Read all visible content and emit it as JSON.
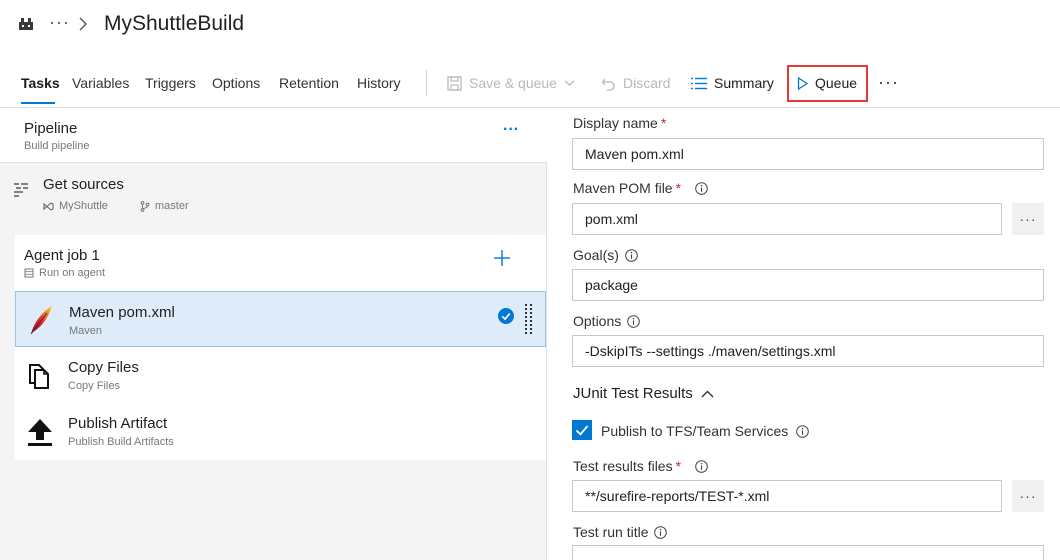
{
  "header": {
    "title": "MyShuttleBuild",
    "ellipsis": "···"
  },
  "tabs": [
    {
      "label": "Tasks",
      "active": true
    },
    {
      "label": "Variables"
    },
    {
      "label": "Triggers"
    },
    {
      "label": "Options"
    },
    {
      "label": "Retention"
    },
    {
      "label": "History"
    }
  ],
  "toolbar": {
    "save_queue": "Save & queue",
    "discard": "Discard",
    "summary": "Summary",
    "queue": "Queue",
    "more": "···",
    "accent_color": "#0078d4",
    "highlight_color": "#e53935"
  },
  "pipeline": {
    "title": "Pipeline",
    "subtitle": "Build pipeline",
    "more": "···"
  },
  "get_sources": {
    "title": "Get sources",
    "repo": "MyShuttle",
    "branch": "master"
  },
  "agent_job": {
    "title": "Agent job 1",
    "subtitle": "Run on agent"
  },
  "tasks": [
    {
      "title": "Maven pom.xml",
      "subtitle": "Maven",
      "selected": true,
      "icon": "maven-feather-icon"
    },
    {
      "title": "Copy Files",
      "subtitle": "Copy Files",
      "icon": "copy-files-icon"
    },
    {
      "title": "Publish Artifact",
      "subtitle": "Publish Build Artifacts",
      "icon": "upload-arrow-icon"
    }
  ],
  "form": {
    "display_name": {
      "label": "Display name",
      "value": "Maven pom.xml"
    },
    "pom_file": {
      "label": "Maven POM file",
      "value": "pom.xml"
    },
    "goals": {
      "label": "Goal(s)",
      "value": "package"
    },
    "options": {
      "label": "Options",
      "value": "-DskipITs --settings ./maven/settings.xml"
    },
    "junit_section": "JUnit Test Results",
    "publish_tfs": {
      "label": "Publish to TFS/Team Services",
      "checked": true
    },
    "test_results_files": {
      "label": "Test results files",
      "value": "**/surefire-reports/TEST-*.xml"
    },
    "test_run_title": {
      "label": "Test run title",
      "value": ""
    },
    "browse": "···",
    "required_mark": "*"
  }
}
